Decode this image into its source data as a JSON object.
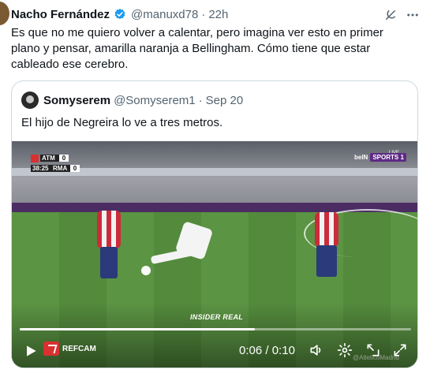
{
  "tweet": {
    "author_name": "Nacho Fernández",
    "handle": "@manuxd78",
    "separator": "·",
    "time": "22h",
    "text": "Es que no me quiero volver a calentar, pero imagina ver esto en primer plano y pensar, amarilla naranja a Bellingham. Cómo tiene que estar cableado ese cerebro."
  },
  "icons": {
    "verified": "verified-badge-icon",
    "grok": "grok-icon",
    "more": "more-icon",
    "play": "play-icon",
    "volume": "volume-icon",
    "settings": "gear-icon",
    "pip": "picture-in-picture-icon",
    "fullscreen": "fullscreen-icon"
  },
  "colors": {
    "verified": "#1d9bf0",
    "muted_text": "#536471",
    "border": "#cfd9de"
  },
  "quote": {
    "author_name": "Somyserem",
    "handle": "@Somyserem1",
    "separator": "·",
    "date": "Sep 20",
    "text": "El hijo de Negreira lo ve a tres metros."
  },
  "video": {
    "scoreboard": {
      "team1": "ATM",
      "score1": "0",
      "clock": "38:25",
      "team2": "RMA",
      "score2": "0"
    },
    "broadcaster": "beIN SPORTS 1",
    "broadcaster_word": "beIN",
    "broadcaster_box": "SPORTS 1",
    "live_label": "LIVE",
    "watermark": "INSIDER REAL",
    "corner_watermark": "@AtleticoMadrid",
    "refcam_label": "REFCAM",
    "current_time": "0:06",
    "time_separator": " / ",
    "duration": "0:10",
    "progress_fraction": 0.6
  }
}
